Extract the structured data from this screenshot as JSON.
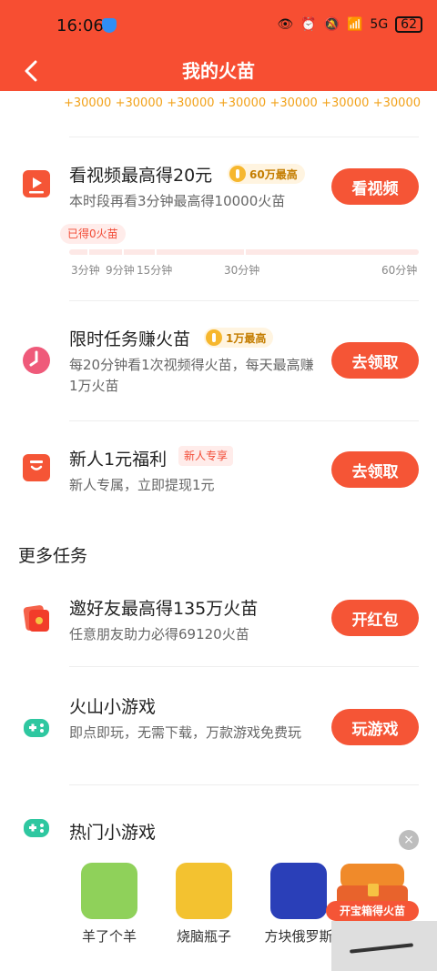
{
  "status_bar": {
    "time": "16:06",
    "battery": "62",
    "signal": "5G"
  },
  "header": {
    "title": "我的火苗"
  },
  "rewards": [
    "+30000",
    "+30000",
    "+30000",
    "+30000",
    "+30000",
    "+30000",
    "+30000"
  ],
  "tasks": [
    {
      "title": "看视频最高得20元",
      "badge": "60万最高",
      "desc": "本时段再看3分钟最高得10000火苗",
      "button": "看视频",
      "progress_chip": "已得0火苗",
      "progress_value": 0,
      "ticks": [
        "3分钟",
        "9分钟",
        "15分钟",
        "30分钟",
        "60分钟"
      ]
    },
    {
      "title": "限时任务赚火苗",
      "badge": "1万最高",
      "desc": "每20分钟看1次视频得火苗，每天最高赚1万火苗",
      "button": "去领取"
    },
    {
      "title": "新人1元福利",
      "badge": "新人专享",
      "desc": "新人专属，立即提现1元",
      "button": "去领取"
    }
  ],
  "more_tasks_title": "更多任务",
  "more_tasks": [
    {
      "title": "邀好友最高得135万火苗",
      "desc": "任意朋友助力必得69120火苗",
      "button": "开红包"
    },
    {
      "title": "火山小游戏",
      "desc": "即点即玩，无需下载，万款游戏免费玩",
      "button": "玩游戏"
    },
    {
      "title": "热门小游戏"
    }
  ],
  "games": [
    {
      "name": "羊了个羊"
    },
    {
      "name": "烧脑瓶子"
    },
    {
      "name": "方块俄罗斯"
    }
  ],
  "treasure": {
    "label": "开宝箱得火苗",
    "close": "×"
  },
  "colors": {
    "accent": "#f55536",
    "header": "#f74e32",
    "gold": "#f2a21a"
  }
}
